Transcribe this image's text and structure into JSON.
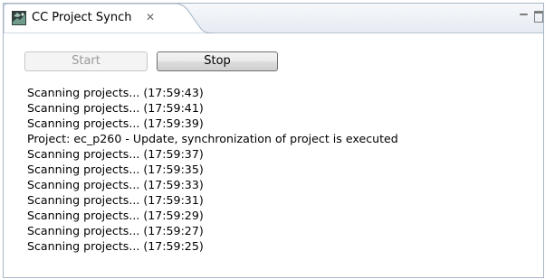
{
  "view": {
    "tab_title": "CC Project Synch",
    "tab_icon": "cc-project-synch-icon",
    "close_glyph": "✕"
  },
  "toolbar": {
    "start_label": "Start",
    "stop_label": "Stop"
  },
  "log": {
    "lines": [
      "Scanning projects... (17:59:43)",
      "Scanning projects... (17:59:41)",
      "Scanning projects... (17:59:39)",
      "Project: ec_p260 - Update, synchronization of project is executed",
      "Scanning projects... (17:59:37)",
      "Scanning projects... (17:59:35)",
      "Scanning projects... (17:59:33)",
      "Scanning projects... (17:59:31)",
      "Scanning projects... (17:59:29)",
      "Scanning projects... (17:59:27)",
      "Scanning projects... (17:59:25)"
    ]
  }
}
